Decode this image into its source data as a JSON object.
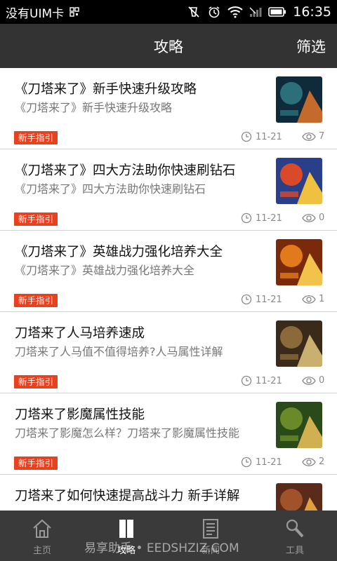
{
  "status_bar": {
    "carrier": "没有UIM卡",
    "time": "16:35"
  },
  "header": {
    "title": "攻略",
    "filter_label": "筛选"
  },
  "articles": [
    {
      "title": "《刀塔来了》新手快速升级攻略",
      "summary": "《刀塔来了》新手快速升级攻略",
      "tag": "新手指引",
      "date": "11-21",
      "views": "7",
      "thumb_colors": [
        "#0f2a3a",
        "#2a6f7a",
        "#c46a2d"
      ]
    },
    {
      "title": "《刀塔来了》四大方法助你快速刷钻石",
      "summary": "《刀塔来了》四大方法助你快速刷钻石",
      "tag": "新手指引",
      "date": "11-21",
      "views": "0",
      "thumb_colors": [
        "#2a3f8a",
        "#d84a2a",
        "#f0c040"
      ]
    },
    {
      "title": "《刀塔来了》英雄战力强化培养大全",
      "summary": "《刀塔来了》英雄战力强化培养大全",
      "tag": "新手指引",
      "date": "11-21",
      "views": "1",
      "thumb_colors": [
        "#7a2a0a",
        "#e07a1a",
        "#f2c24a"
      ]
    },
    {
      "title": "刀塔来了人马培养速成",
      "summary": "刀塔来了人马值不值得培养?人马属性详解",
      "tag": "新手指引",
      "date": "11-21",
      "views": "0",
      "thumb_colors": [
        "#3a2a1a",
        "#8a6a3a",
        "#c9b070"
      ]
    },
    {
      "title": "刀塔来了影魔属性技能",
      "summary": "刀塔来了影魔怎么样？刀塔来了影魔属性技能",
      "tag": "新手指引",
      "date": "11-21",
      "views": "2",
      "thumb_colors": [
        "#2a4a1a",
        "#6a8a2a",
        "#d0b050"
      ]
    },
    {
      "title": "刀塔来了如何快速提高战斗力 新手详解",
      "summary": "",
      "tag": "",
      "date": "",
      "views": "",
      "thumb_colors": [
        "#5a2a1a",
        "#a0522a",
        "#e0a040"
      ]
    }
  ],
  "tab_bar": {
    "tabs": [
      {
        "label": "主页",
        "icon": "home-icon",
        "active": false
      },
      {
        "label": "攻略",
        "icon": "book-icon",
        "active": true
      },
      {
        "label": "新闻",
        "icon": "news-icon",
        "active": false
      },
      {
        "label": "工具",
        "icon": "wrench-icon",
        "active": false
      }
    ]
  },
  "watermark": "易享助手 • EEDSHZIZ.COM",
  "colors": {
    "header": "#333333",
    "tag": "#e8411f",
    "tab_bar": "#3a3a3a"
  }
}
